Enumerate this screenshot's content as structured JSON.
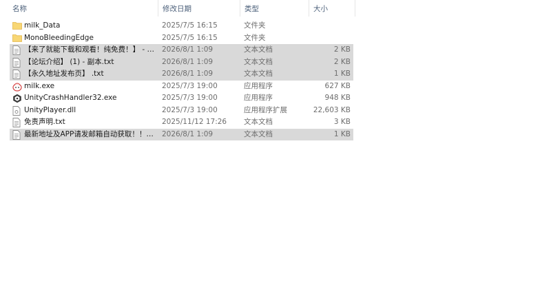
{
  "columns": {
    "name": "名称",
    "date": "修改日期",
    "type": "类型",
    "size": "大小"
  },
  "files": [
    {
      "name": "milk_Data",
      "date": "2025/7/5 16:15",
      "type": "文件夹",
      "size": "",
      "icon": "folder-icon",
      "selected": false
    },
    {
      "name": "MonoBleedingEdge",
      "date": "2025/7/5 16:15",
      "type": "文件夹",
      "size": "",
      "icon": "folder-icon",
      "selected": false
    },
    {
      "name": "【来了就能下载和观看！纯免费！】 - 副...",
      "date": "2026/8/1 1:09",
      "type": "文本文档",
      "size": "2 KB",
      "icon": "text-file-icon",
      "selected": true
    },
    {
      "name": "【论坛介绍】 (1) - 副本.txt",
      "date": "2026/8/1 1:09",
      "type": "文本文档",
      "size": "2 KB",
      "icon": "text-file-icon",
      "selected": true
    },
    {
      "name": "【永久地址发布页】 .txt",
      "date": "2026/8/1 1:09",
      "type": "文本文档",
      "size": "1 KB",
      "icon": "text-file-icon",
      "selected": true
    },
    {
      "name": "milk.exe",
      "date": "2025/7/3 19:00",
      "type": "应用程序",
      "size": "627 KB",
      "icon": "app-milk-icon",
      "selected": false
    },
    {
      "name": "UnityCrashHandler32.exe",
      "date": "2025/7/3 19:00",
      "type": "应用程序",
      "size": "948 KB",
      "icon": "unity-icon",
      "selected": false
    },
    {
      "name": "UnityPlayer.dll",
      "date": "2025/7/3 19:00",
      "type": "应用程序扩展",
      "size": "22,603 KB",
      "icon": "dll-file-icon",
      "selected": false
    },
    {
      "name": "免责声明.txt",
      "date": "2025/11/12 17:26",
      "type": "文本文档",
      "size": "3 KB",
      "icon": "text-file-icon",
      "selected": false
    },
    {
      "name": "最新地址及APP请发邮箱自动获取！！！...",
      "date": "2026/8/1 1:09",
      "type": "文本文档",
      "size": "1 KB",
      "icon": "text-file-icon",
      "selected": true
    }
  ],
  "colors": {
    "folder": "#f8d775",
    "selection": "#d9d9d9",
    "header_text": "#4c607a"
  }
}
